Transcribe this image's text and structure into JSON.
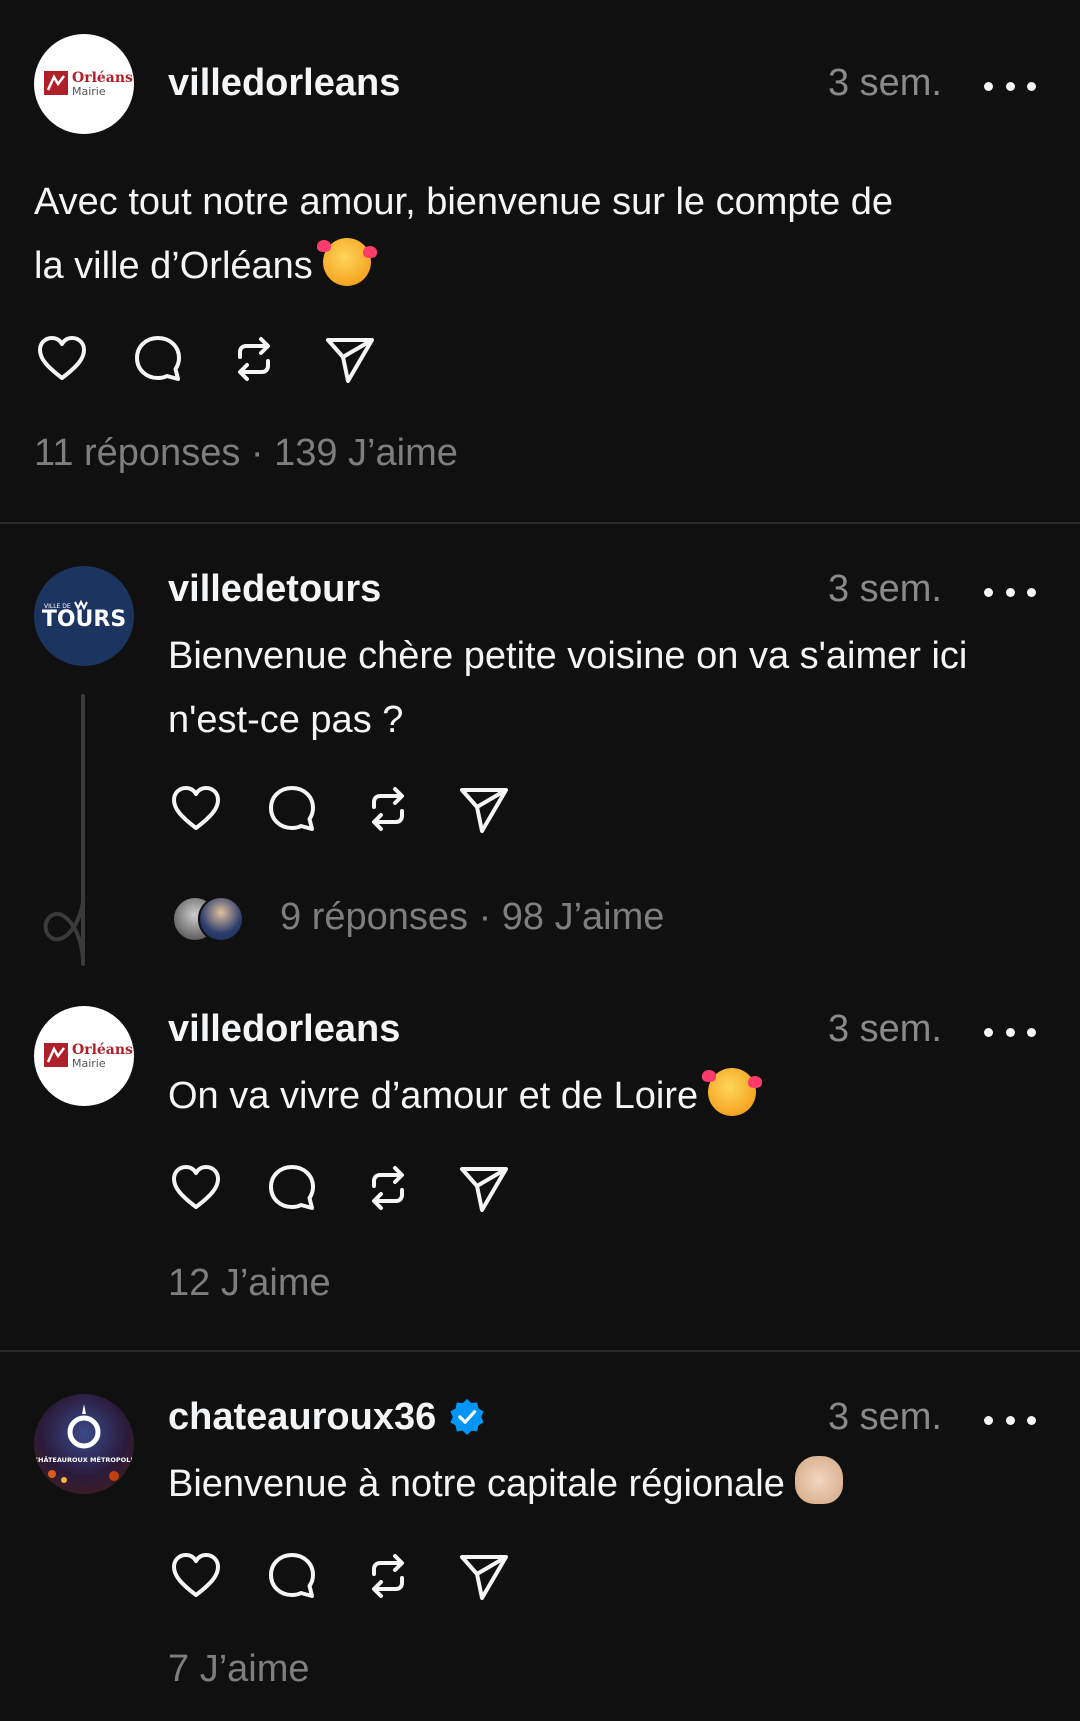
{
  "posts": [
    {
      "username": "villedorleans",
      "avatar_text": "Orléans Mairie",
      "time": "3 sem.",
      "text_line1": "Avec tout notre amour, bienvenue sur le compte de",
      "text_line2": "la ville d’Orléans",
      "emoji": "smiling-face-with-hearts",
      "meta": "11 réponses · 139 J’aime"
    },
    {
      "username": "villedetours",
      "avatar_text_small": "VILLE DE",
      "avatar_text": "TOURS",
      "time": "3 sem.",
      "text_line1": "Bienvenue chère petite voisine on va s'aimer ici",
      "text_line2": "n'est-ce pas ?",
      "meta": "9 réponses · 98 J’aime"
    },
    {
      "username": "villedorleans",
      "avatar_text": "Orléans Mairie",
      "time": "3 sem.",
      "text_line1": "On va vivre d’amour et de Loire",
      "emoji": "smiling-face-with-hearts",
      "meta": "12 J’aime"
    },
    {
      "username": "chateauroux36",
      "verified": true,
      "avatar_text": "CHÂTEAUROUX MÉTROPOLE",
      "time": "3 sem.",
      "text_line1": "Bienvenue à notre capitale régionale",
      "emoji": "waving-hand",
      "meta": "7 J’aime"
    }
  ],
  "icons": [
    "heart-icon",
    "comment-icon",
    "repost-icon",
    "share-icon",
    "more-icon",
    "verified-badge-icon"
  ],
  "colors": {
    "background": "#101010",
    "text": "#f3f5f7",
    "muted": "#8a8a8a",
    "verified": "#0095f6"
  }
}
